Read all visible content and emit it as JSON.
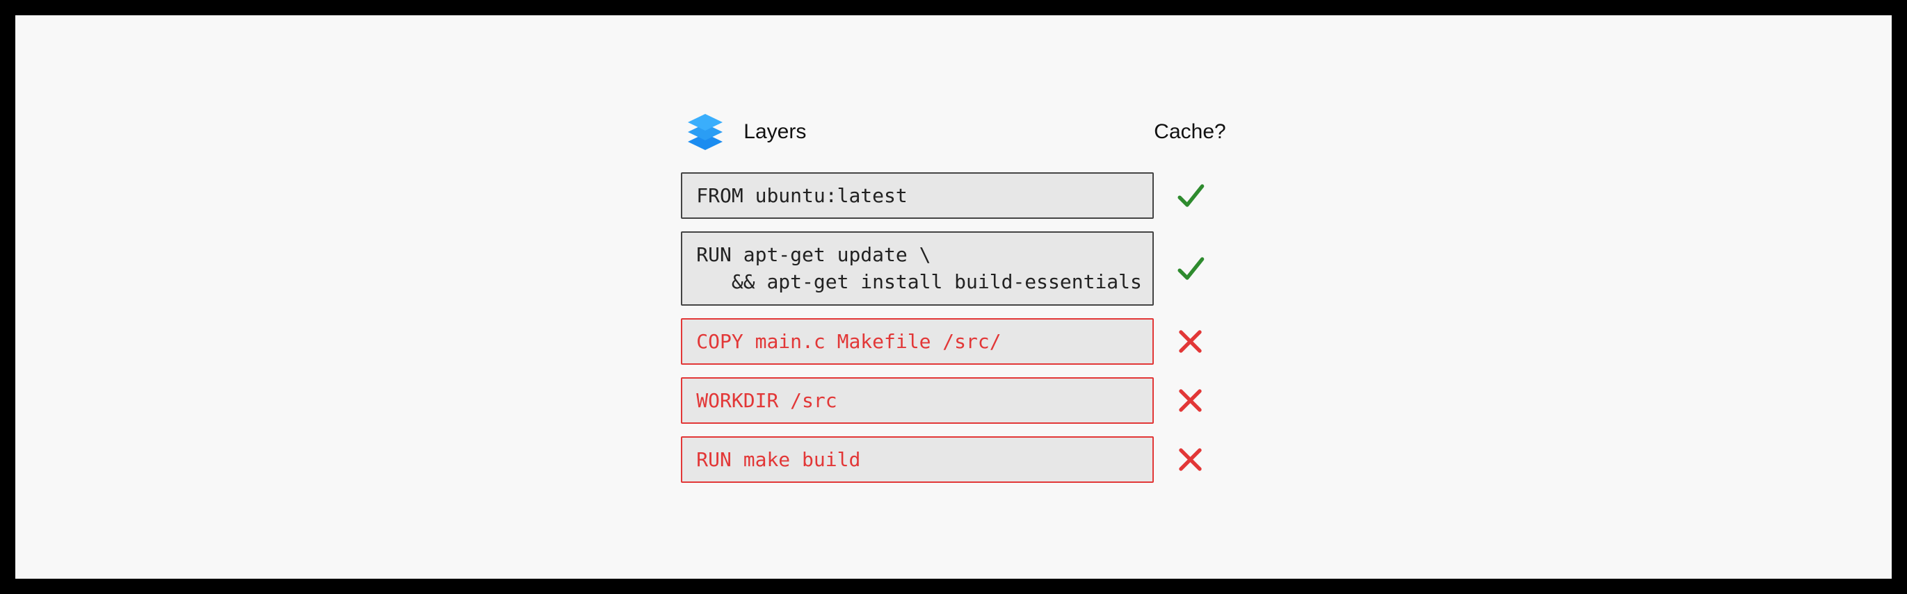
{
  "header": {
    "layers_label": "Layers",
    "cache_label": "Cache?"
  },
  "layers": [
    {
      "code": "FROM ubuntu:latest",
      "cached": true,
      "invalidated": false
    },
    {
      "code": "RUN apt-get update \\\n   && apt-get install build-essentials",
      "cached": true,
      "invalidated": false
    },
    {
      "code": "COPY main.c Makefile /src/",
      "cached": false,
      "invalidated": true
    },
    {
      "code": "WORKDIR /src",
      "cached": false,
      "invalidated": true
    },
    {
      "code": "RUN make build",
      "cached": false,
      "invalidated": true
    }
  ],
  "colors": {
    "cached_check": "#2e8b2e",
    "invalidated": "#e23737",
    "layer_bg": "#e7e7e7",
    "layer_border_default": "#444444"
  }
}
